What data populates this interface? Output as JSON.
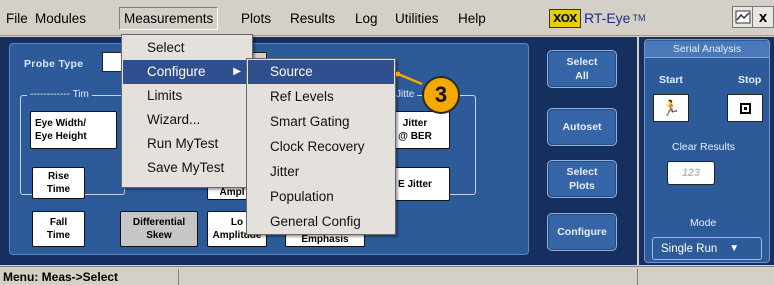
{
  "menubar": {
    "items": [
      "File",
      "Modules",
      "Measurements",
      "Plots",
      "Results",
      "Log",
      "Utilities",
      "Help"
    ],
    "logo_mark": "XOX",
    "logo_text": "RT-Eye",
    "logo_sup": "TM",
    "close_label": "x"
  },
  "probe": {
    "label": "Probe Type"
  },
  "groups": {
    "timing_legend": "Tim",
    "jitter_legend": "Jitte"
  },
  "measurements": {
    "eye_width_1": "Eye Width/",
    "eye_width_2": "Eye Height",
    "rise_1": "Rise",
    "rise_2": "Time",
    "fall_1": "Fall",
    "fall_2": "Time",
    "diff_1": "Differential",
    "diff_2": "Skew",
    "amp_partial": "Ampl",
    "lo_1": "Lo",
    "lo_2": "Amplitude",
    "emph_partial": "Emphasis",
    "jitter_1": "Jitter",
    "jitter_2": "@ BER",
    "ejitter": "E Jitter"
  },
  "side_buttons": {
    "select_all_1": "Select",
    "select_all_2": "All",
    "autoset": "Autoset",
    "select_plots_1": "Select",
    "select_plots_2": "Plots",
    "configure": "Configure"
  },
  "serial": {
    "title": "Serial Analysis",
    "start": "Start",
    "stop": "Stop",
    "clear": "Clear Results",
    "clear_btn": "123",
    "mode_label": "Mode",
    "mode_value": "Single Run"
  },
  "meas_menu": [
    "Select",
    "Configure",
    "Limits",
    "Wizard...",
    "Run MyTest",
    "Save MyTest"
  ],
  "configure_submenu": [
    "Source",
    "Ref Levels",
    "Smart Gating",
    "Clock Recovery",
    "Jitter",
    "Population",
    "General Config"
  ],
  "callout": "3",
  "status": {
    "text": "Menu: Meas->Select"
  },
  "colors": {
    "panel": "#2d5b9a",
    "background": "#15305f",
    "highlight": "#2f4f8e",
    "callout": "#f4a800"
  }
}
